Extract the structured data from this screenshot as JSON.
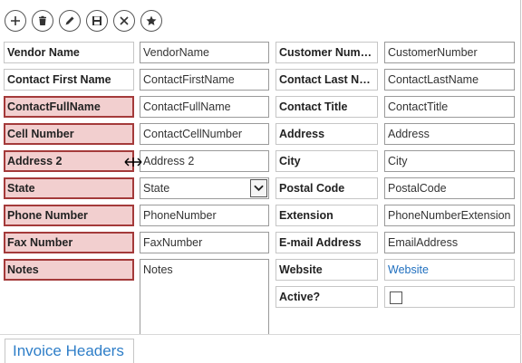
{
  "toolbar": {
    "buttons": [
      {
        "name": "add-icon"
      },
      {
        "name": "delete-icon"
      },
      {
        "name": "edit-icon"
      },
      {
        "name": "save-icon"
      },
      {
        "name": "cancel-icon"
      },
      {
        "name": "star-icon"
      }
    ]
  },
  "left": {
    "vendor_name": {
      "label": "Vendor Name",
      "value": "VendorName"
    },
    "contact_first": {
      "label": "Contact First Name",
      "value": "ContactFirstName"
    },
    "contact_full": {
      "label": "ContactFullName",
      "value": "ContactFullName"
    },
    "cell": {
      "label": "Cell Number",
      "value": "ContactCellNumber"
    },
    "address2": {
      "label": "Address 2",
      "value": "Address 2"
    },
    "state": {
      "label": "State",
      "value": "State"
    },
    "phone": {
      "label": "Phone Number",
      "value": "PhoneNumber"
    },
    "fax": {
      "label": "Fax Number",
      "value": "FaxNumber"
    },
    "notes": {
      "label": "Notes",
      "value": "Notes"
    }
  },
  "right": {
    "customer_number": {
      "label": "Customer Num…",
      "value": "CustomerNumber"
    },
    "contact_last": {
      "label": "Contact Last N…",
      "value": "ContactLastName"
    },
    "contact_title": {
      "label": "Contact Title",
      "value": "ContactTitle"
    },
    "address": {
      "label": "Address",
      "value": "Address"
    },
    "city": {
      "label": "City",
      "value": "City"
    },
    "postal": {
      "label": "Postal Code",
      "value": "PostalCode"
    },
    "extension": {
      "label": "Extension",
      "value": "PhoneNumberExtension"
    },
    "email": {
      "label": "E-mail Address",
      "value": "EmailAddress"
    },
    "website": {
      "label": "Website",
      "value": "Website"
    },
    "active": {
      "label": "Active?",
      "checked": false
    }
  },
  "tabs": {
    "invoice_headers": "Invoice Headers"
  },
  "colors": {
    "highlight_fill": "#f2cfcf",
    "highlight_border": "#a43a3a",
    "link": "#1f6fbf"
  }
}
